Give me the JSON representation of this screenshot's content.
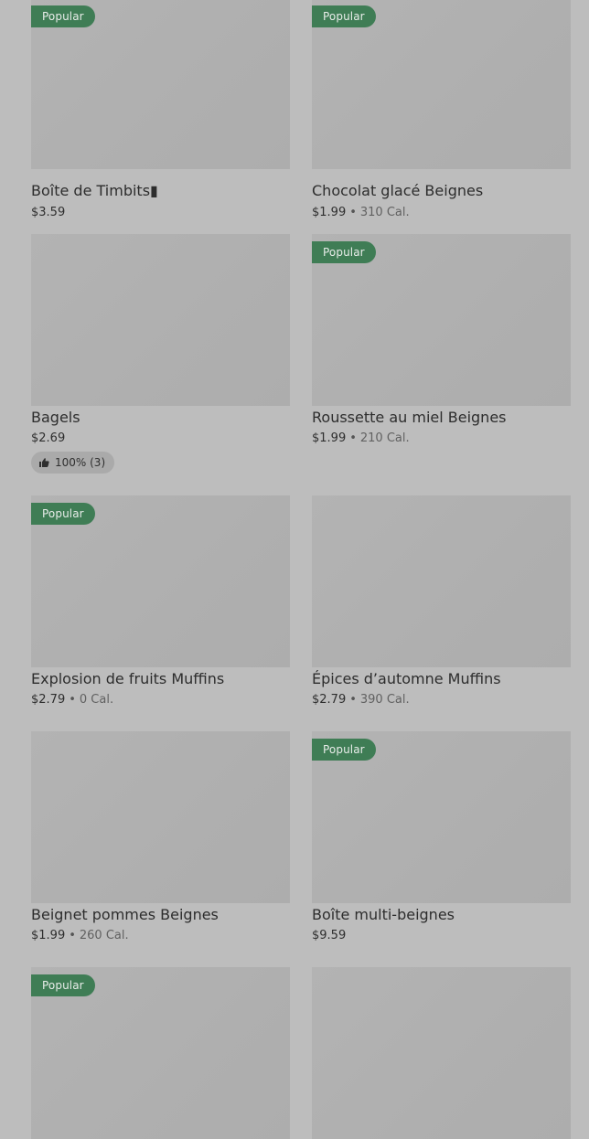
{
  "items": [
    {
      "title": "Boîte de Timbits▮",
      "price": "$3.59",
      "calories": "",
      "badge": "Popular",
      "rating": ""
    },
    {
      "title": "Chocolat glacé Beignes",
      "price": "$1.99",
      "calories": "310 Cal.",
      "badge": "Popular",
      "rating": ""
    },
    {
      "title": "Bagels",
      "price": "$2.69",
      "calories": "",
      "badge": "",
      "rating": "100% (3)"
    },
    {
      "title": "Roussette au miel Beignes",
      "price": "$1.99",
      "calories": "210 Cal.",
      "badge": "Popular",
      "rating": ""
    },
    {
      "title": "Explosion de fruits Muffins",
      "price": "$2.79",
      "calories": "0 Cal.",
      "badge": "Popular",
      "rating": ""
    },
    {
      "title": "Épices d’automne Muffins",
      "price": "$2.79",
      "calories": "390 Cal.",
      "badge": "",
      "rating": ""
    },
    {
      "title": "Beignet pommes Beignes",
      "price": "$1.99",
      "calories": "260 Cal.",
      "badge": "",
      "rating": ""
    },
    {
      "title": "Boîte multi-beignes",
      "price": "$9.59",
      "calories": "",
      "badge": "Popular",
      "rating": ""
    },
    {
      "title": "",
      "price": "",
      "calories": "",
      "badge": "Popular",
      "rating": ""
    },
    {
      "title": "",
      "price": "",
      "calories": "",
      "badge": "",
      "rating": ""
    }
  ],
  "icons": {
    "thumbs_up": "thumbs-up-icon"
  }
}
